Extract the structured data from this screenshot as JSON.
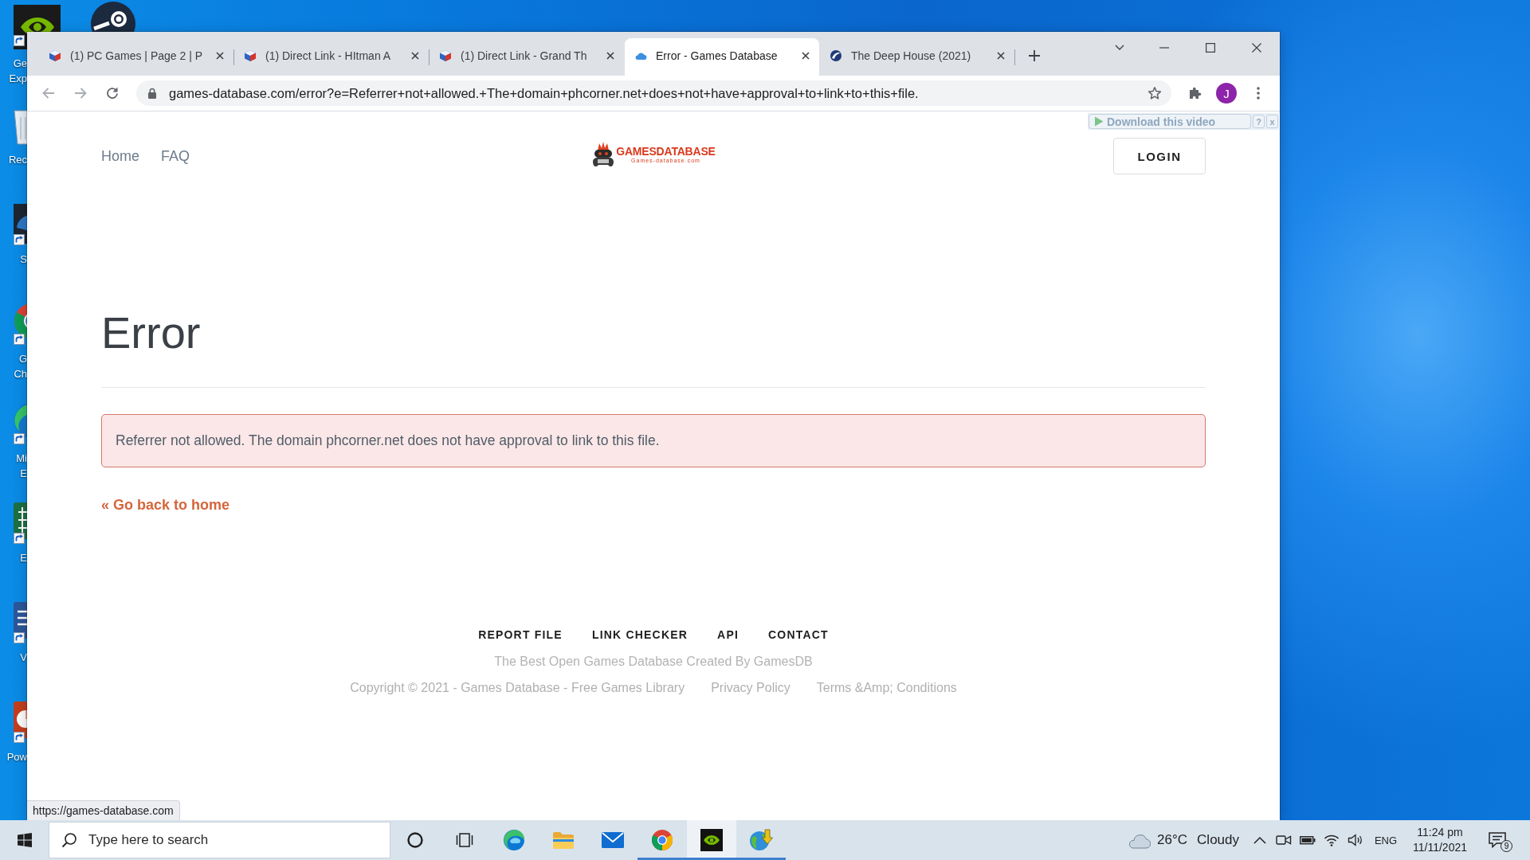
{
  "desktop": {
    "icons": [
      {
        "kind": "eye",
        "label": [
          "Ge",
          "Exp"
        ]
      },
      {
        "kind": "bin",
        "label": [
          "Rec"
        ]
      },
      {
        "kind": "tile",
        "label": [
          "S"
        ]
      },
      {
        "kind": "chrome",
        "label": [
          "G",
          "Ch"
        ]
      },
      {
        "kind": "edge",
        "label": [
          "Mi",
          "E"
        ]
      },
      {
        "kind": "excel",
        "label": [
          "E"
        ]
      },
      {
        "kind": "word",
        "label": [
          "V"
        ]
      },
      {
        "kind": "ppt",
        "label": [
          "Pow"
        ]
      }
    ]
  },
  "browser": {
    "tabs": [
      {
        "kind": "cube",
        "title": "(1) PC Games | Page 2 | P",
        "selected": false
      },
      {
        "kind": "cube",
        "title": "(1) Direct Link - HItman A",
        "selected": false
      },
      {
        "kind": "cube",
        "title": "(1) Direct Link - Grand Th",
        "selected": false
      },
      {
        "kind": "cloud",
        "title": "Error - Games Database",
        "selected": true
      },
      {
        "kind": "swoosh",
        "title": "The Deep House (2021)",
        "selected": false
      }
    ],
    "navigation": [
      {
        "kind": "back",
        "disabled": true
      },
      {
        "kind": "forward",
        "disabled": true
      },
      {
        "kind": "reload",
        "disabled": false
      }
    ],
    "url": "games-database.com/error?e=Referrer+not+allowed.+The+domain+phcorner.net+does+not+have+approval+to+link+to+this+file.",
    "profile_initial": "J",
    "status_url": "https://games-database.com"
  },
  "page": {
    "nav": [
      "Home",
      "FAQ"
    ],
    "logo": {
      "name": "GAMESDATABASE",
      "tagline": "Games-database.com"
    },
    "login": "LOGIN",
    "heading": "Error",
    "alert": "Referrer not allowed. The domain phcorner.net does not have approval to link to this file.",
    "back_link": "« Go back to home",
    "footer_nav": [
      "REPORT FILE",
      "LINK CHECKER",
      "API",
      "CONTACT"
    ],
    "tagline": "The Best Open Games Database Created By GamesDB",
    "copyright": "Copyright © 2021 - Games Database - Free Games Library",
    "footer_links": [
      "Privacy Policy",
      "Terms &Amp; Conditions"
    ]
  },
  "video_overlay": {
    "label": "Download this video",
    "help": "?",
    "close": "x"
  },
  "taskbar": {
    "search": {
      "placeholder": "Type here to search"
    },
    "apps": [
      {
        "kind": "cortana",
        "running": false,
        "focused": false
      },
      {
        "kind": "taskview",
        "running": false,
        "focused": false
      },
      {
        "kind": "edge",
        "running": false,
        "focused": false
      },
      {
        "kind": "explorer",
        "running": false,
        "focused": false
      },
      {
        "kind": "mail",
        "running": false,
        "focused": false
      },
      {
        "kind": "chrome",
        "running": true,
        "focused": false
      },
      {
        "kind": "nvidia",
        "running": true,
        "focused": true
      },
      {
        "kind": "idm",
        "running": true,
        "focused": false
      }
    ],
    "weather": {
      "temperature": "26°C",
      "condition": "Cloudy"
    },
    "language": "ENG",
    "time": "11:24 pm",
    "date": "11/11/2021",
    "notifications": "9"
  }
}
